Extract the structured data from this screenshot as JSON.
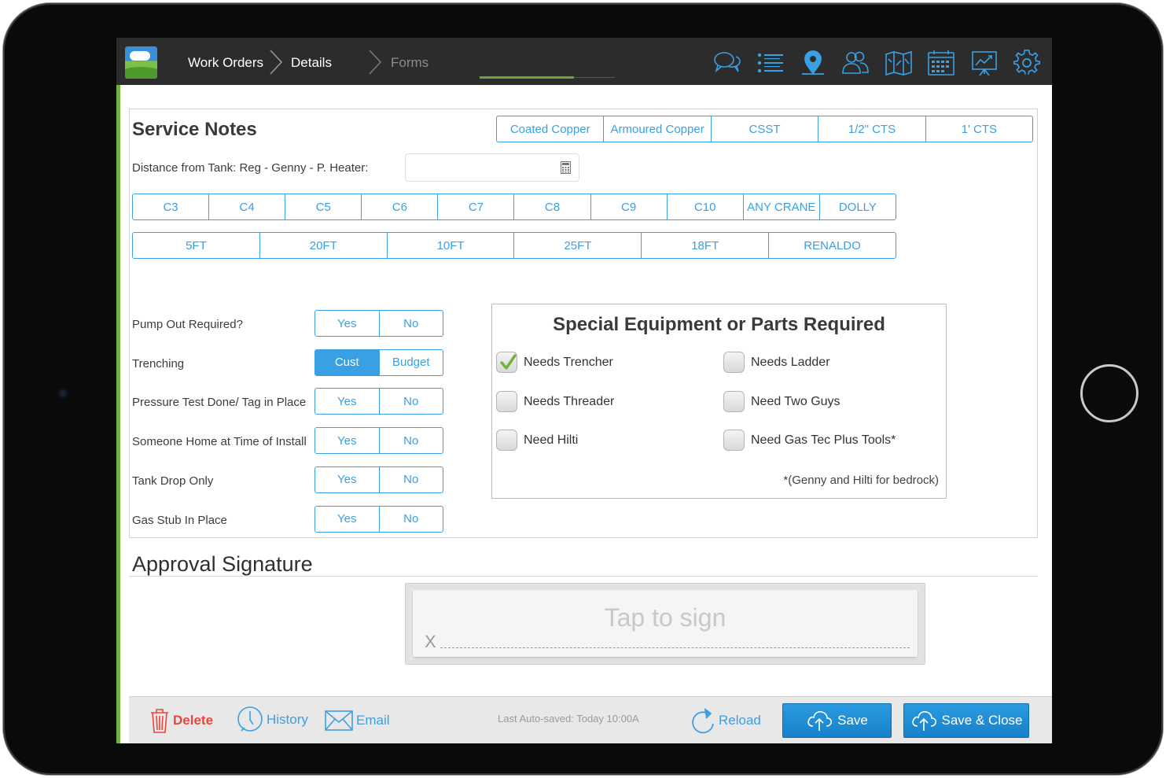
{
  "nav": {
    "crumbs": [
      "Work Orders",
      "Details",
      "Forms"
    ],
    "icons": [
      "chat-icon",
      "list-icon",
      "map-pin-icon",
      "users-icon",
      "map-icon",
      "calendar-icon",
      "chart-icon",
      "gear-icon"
    ]
  },
  "service_notes": {
    "title": "Service Notes",
    "pipe_types": [
      "Coated Copper",
      "Armoured Copper",
      "CSST",
      "1/2\" CTS",
      "1' CTS"
    ],
    "distance_label": "Distance from Tank: Reg - Genny - P. Heater:",
    "distance_value": "",
    "codes_row1": [
      "C3",
      "C4",
      "C5",
      "C6",
      "C7",
      "C8",
      "C9",
      "C10",
      "ANY CRANE",
      "DOLLY"
    ],
    "codes_row2": [
      "5FT",
      "20FT",
      "10FT",
      "25FT",
      "18FT",
      "RENALDO"
    ]
  },
  "questions": [
    {
      "label": "Pump Out Required?",
      "options": [
        "Yes",
        "No"
      ],
      "selected": -1
    },
    {
      "label": "Trenching",
      "options": [
        "Cust",
        "Budget"
      ],
      "selected": 0
    },
    {
      "label": "Pressure Test Done/ Tag in Place",
      "options": [
        "Yes",
        "No"
      ],
      "selected": -1
    },
    {
      "label": "Someone Home at Time of Install",
      "options": [
        "Yes",
        "No"
      ],
      "selected": -1
    },
    {
      "label": "Tank Drop Only",
      "options": [
        "Yes",
        "No"
      ],
      "selected": -1
    },
    {
      "label": "Gas Stub In Place",
      "options": [
        "Yes",
        "No"
      ],
      "selected": -1
    }
  ],
  "equipment": {
    "title": "Special Equipment or Parts Required",
    "items": [
      {
        "label": "Needs Trencher",
        "checked": true
      },
      {
        "label": "Needs Ladder",
        "checked": false
      },
      {
        "label": "Needs Threader",
        "checked": false
      },
      {
        "label": "Need Two Guys",
        "checked": false
      },
      {
        "label": "Need Hilti",
        "checked": false
      },
      {
        "label": "Need Gas Tec Plus Tools*",
        "checked": false
      }
    ],
    "footnote": "*(Genny and Hilti for bedrock)"
  },
  "signature": {
    "title": "Approval Signature",
    "hint": "Tap to sign",
    "x_mark": "X"
  },
  "bottom": {
    "delete": "Delete",
    "history": "History",
    "email": "Email",
    "autosave": "Last Auto-saved: Today 10:00A",
    "reload": "Reload",
    "save": "Save",
    "save_close": "Save & Close"
  },
  "colors": {
    "accent": "#3aa0e4",
    "delete": "#e8473c",
    "brand_green": "#6fb23d"
  }
}
